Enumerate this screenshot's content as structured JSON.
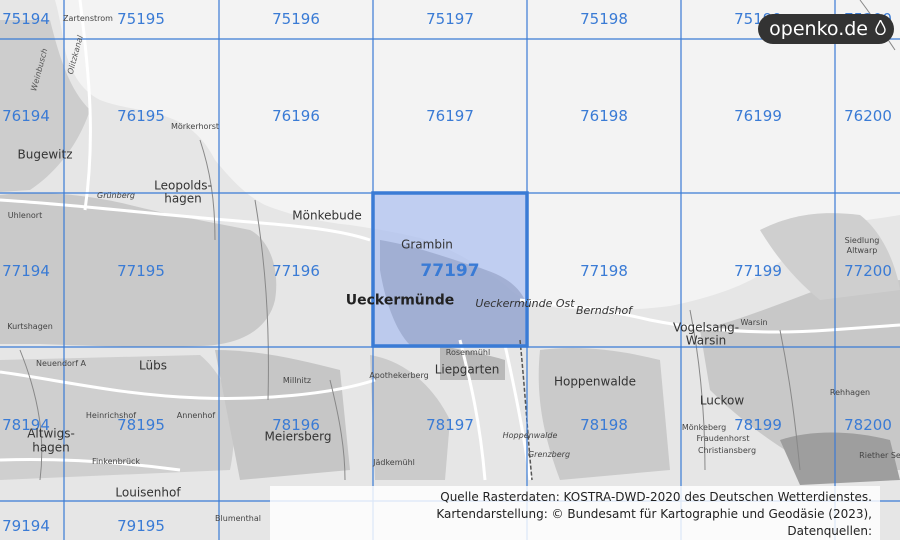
{
  "map": {
    "highlight_tile": "77197",
    "grid_color": "#3a7bd5",
    "highlight_fill": "#a9bdf0",
    "grid_labels": [
      {
        "id": "r0c0",
        "text": "75194"
      },
      {
        "id": "r0c1",
        "text": "75195"
      },
      {
        "id": "r0c2",
        "text": "75196"
      },
      {
        "id": "r0c3",
        "text": "75197"
      },
      {
        "id": "r0c4",
        "text": "75198"
      },
      {
        "id": "r0c5",
        "text": "75199"
      },
      {
        "id": "r0c6",
        "text": "75200"
      },
      {
        "id": "r1c0",
        "text": "76194"
      },
      {
        "id": "r1c1",
        "text": "76195"
      },
      {
        "id": "r1c2",
        "text": "76196"
      },
      {
        "id": "r1c3",
        "text": "76197"
      },
      {
        "id": "r1c4",
        "text": "76198"
      },
      {
        "id": "r1c5",
        "text": "76199"
      },
      {
        "id": "r1c6",
        "text": "76200"
      },
      {
        "id": "r2c0",
        "text": "77194"
      },
      {
        "id": "r2c1",
        "text": "77195"
      },
      {
        "id": "r2c2",
        "text": "77196"
      },
      {
        "id": "r2c3",
        "text": "77197"
      },
      {
        "id": "r2c4",
        "text": "77198"
      },
      {
        "id": "r2c5",
        "text": "77199"
      },
      {
        "id": "r2c6",
        "text": "77200"
      },
      {
        "id": "r3c0",
        "text": "78194"
      },
      {
        "id": "r3c1",
        "text": "78195"
      },
      {
        "id": "r3c2",
        "text": "78196"
      },
      {
        "id": "r3c3",
        "text": "78197"
      },
      {
        "id": "r3c4",
        "text": "78198"
      },
      {
        "id": "r3c5",
        "text": "78199"
      },
      {
        "id": "r3c6",
        "text": "78200"
      },
      {
        "id": "r4c0",
        "text": "79194"
      },
      {
        "id": "r4c1",
        "text": "79195"
      }
    ],
    "places": {
      "zartenstrom": "Zartenstrom",
      "bugewitz": "Bugewitz",
      "moerkerhorst": "Mörkerhorst",
      "leopoldshagen_1": "Leopolds-",
      "leopoldshagen_2": "hagen",
      "gruenberg": "Grünberg",
      "uhlenort": "Uhlenort",
      "kurtshagen": "Kurtshagen",
      "moenkebude": "Mönkebude",
      "grambin": "Grambin",
      "ueckermuende": "Ueckermünde",
      "ueckermuende_ost": "Ueckermünde Ost",
      "berndshof": "Berndshof",
      "vogelsang_1": "Vogelsang-",
      "vogelsang_2": "Warsin",
      "warsin": "Warsin",
      "siedlung_1": "Siedlung",
      "siedlung_2": "Altwarp",
      "neuendorf": "Neuendorf A",
      "luebs": "Lübs",
      "millnitz": "Millnitz",
      "rosenmuehl": "Rosenmühl",
      "liepgarten": "Liepgarten",
      "hoppenwalde": "Hoppenwalde",
      "luckow": "Luckow",
      "rehhagen": "Rehhagen",
      "heinrichshof": "Heinrichshof",
      "annenhof": "Annenhof",
      "altwigshagen_1": "Altwigs-",
      "altwigshagen_2": "hagen",
      "meiersberg": "Meiersberg",
      "moenkeberg": "Mönkeberg",
      "fraudenhorst": "Fraudenhorst",
      "christiansberg": "Christiansberg",
      "finkenbrueck": "Finkenbrück",
      "louisenhof": "Louisenhof",
      "jaedkemuehl": "Jädkemühl",
      "grenzberg": "Grenzberg",
      "blumenthal": "Blumenthal",
      "riether": "Riether Se",
      "apothekerberg": "Apothekerberg",
      "hoppenwalde_small": "Hoppenwalde",
      "weinbusch": "Weinbusch",
      "olitzkanal": "Olitzkanal"
    }
  },
  "logo": {
    "text": "openko.de"
  },
  "credits": {
    "line1": "Quelle Rasterdaten: KOSTRA-DWD-2020 des Deutschen Wetterdienstes.",
    "line2": "Kartendarstellung: © Bundesamt für Kartographie und Geodäsie (2023),",
    "line3": "Datenquellen: https://sgx.geodatenzentrum.de/web_public/gdz/datenquellen/Datenquellen_TopPlusOpen.html"
  }
}
